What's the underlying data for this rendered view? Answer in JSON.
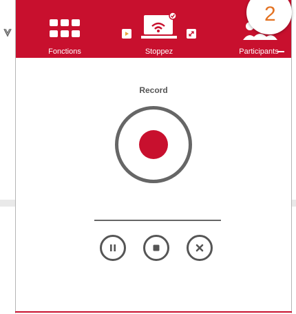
{
  "toolbar": {
    "fonctions_label": "Fonctions",
    "stoppez_label": "Stoppez",
    "participants_label": "Participants"
  },
  "badge": {
    "number": "2"
  },
  "recorder": {
    "title": "Record",
    "buttons": [
      "record-icon",
      "pause-icon",
      "stop-icon",
      "close-icon"
    ]
  },
  "colors": {
    "brand_red": "#c8102e",
    "badge_orange": "#e37222",
    "control_gray": "#555555"
  }
}
